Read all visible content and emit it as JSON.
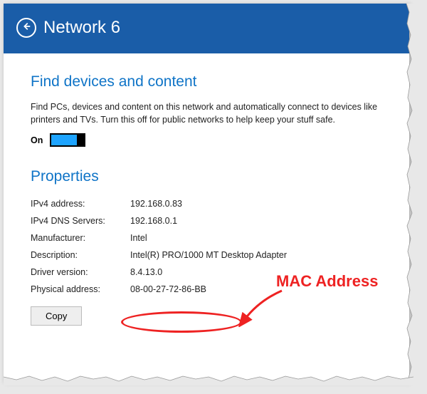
{
  "header": {
    "title": "Network  6"
  },
  "find": {
    "title": "Find devices and content",
    "desc": "Find PCs, devices and content on this network and automatically connect to devices like printers and TVs. Turn this off for public networks to help keep your stuff safe.",
    "toggle_label": "On"
  },
  "properties": {
    "title": "Properties",
    "rows": [
      {
        "label": "IPv4 address:",
        "value": "192.168.0.83"
      },
      {
        "label": "IPv4 DNS Servers:",
        "value": "192.168.0.1"
      },
      {
        "label": "Manufacturer:",
        "value": "Intel"
      },
      {
        "label": "Description:",
        "value": "Intel(R) PRO/1000 MT Desktop Adapter"
      },
      {
        "label": "Driver version:",
        "value": "8.4.13.0"
      },
      {
        "label": "Physical address:",
        "value": "08-00-27-72-86-BB"
      }
    ],
    "copy_label": "Copy"
  },
  "annotation": {
    "label": "MAC Address"
  }
}
